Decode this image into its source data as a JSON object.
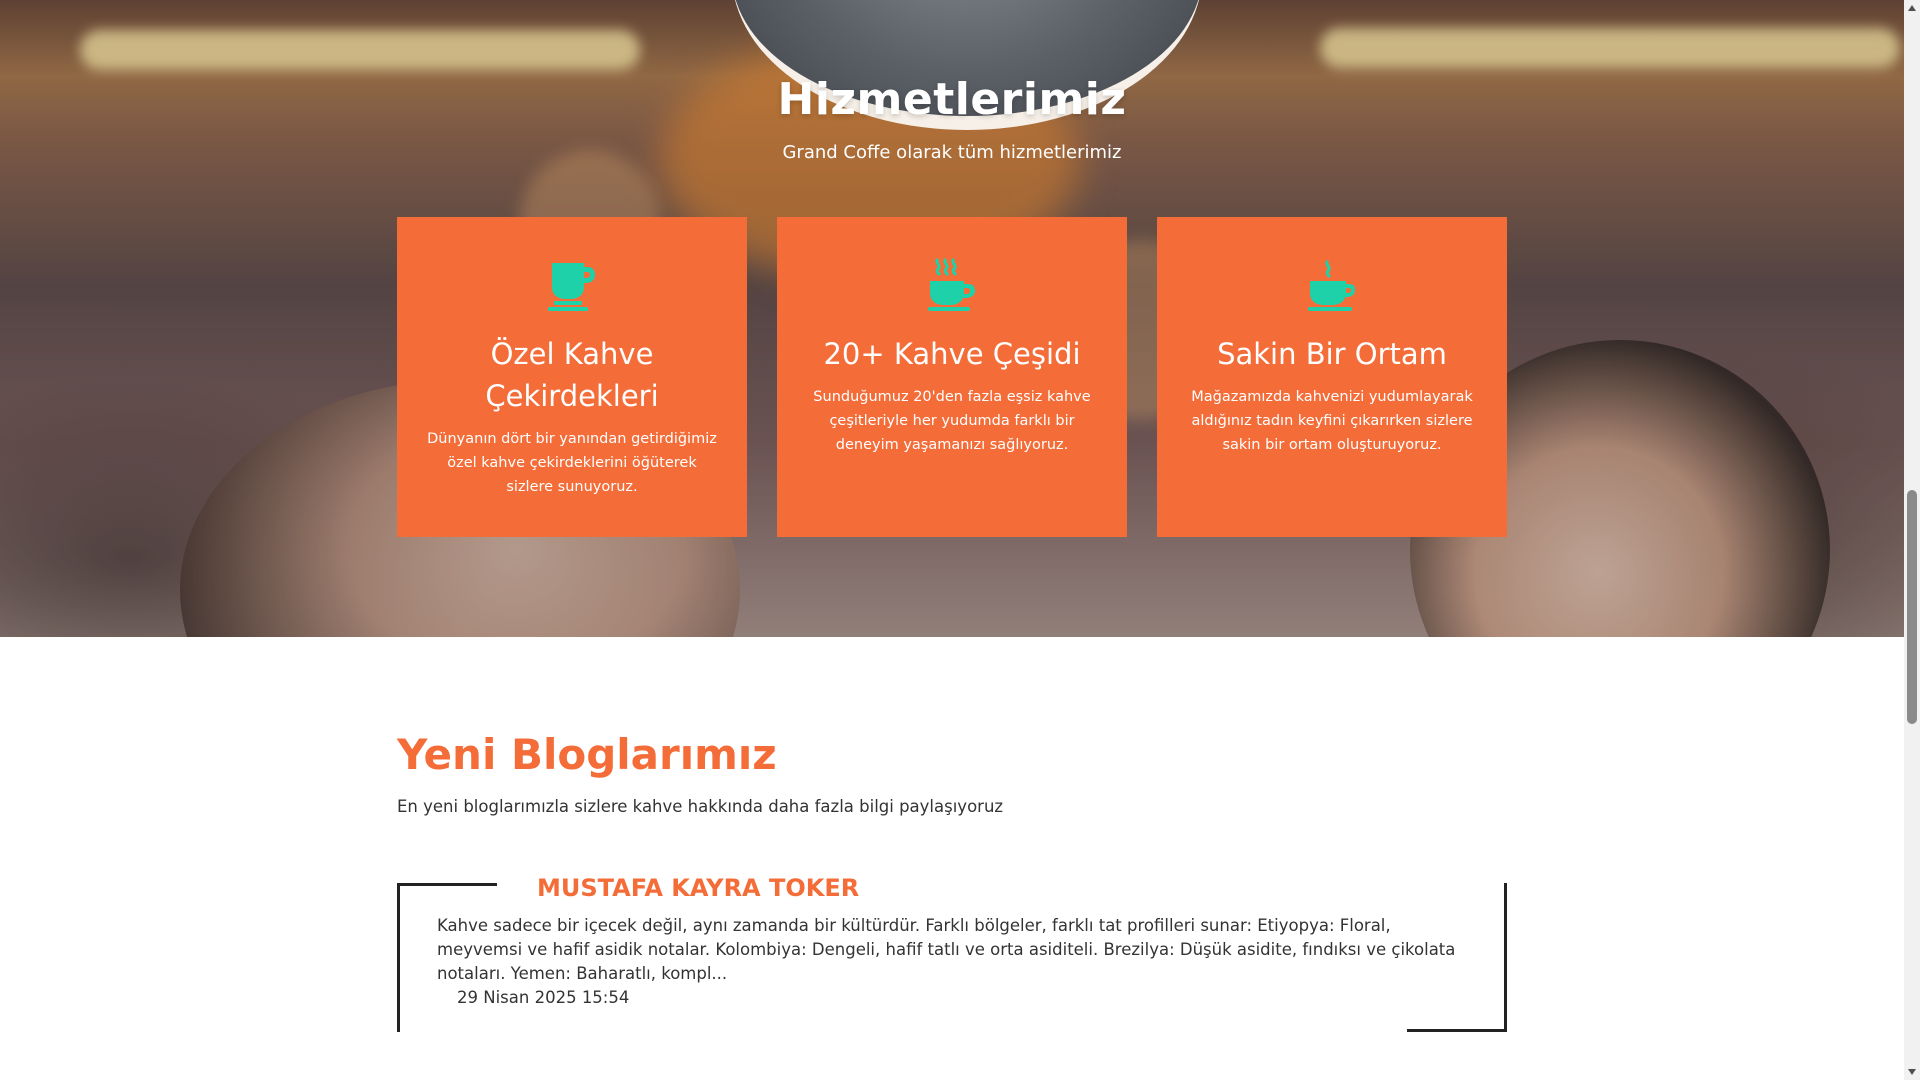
{
  "hero": {
    "title": "Hizmetlerimiz",
    "subtitle": "Grand Coffe olarak tüm hizmetlerimiz"
  },
  "services": [
    {
      "icon": "coffee-mug-icon",
      "title": "Özel Kahve Çekirdekleri",
      "text": "Dünyanın dört bir yanından getirdiğimiz özel kahve çekirdeklerini öğüterek sizlere sunuyoruz."
    },
    {
      "icon": "hot-coffee-cup-icon",
      "title": "20+ Kahve Çeşidi",
      "text": "Sunduğumuz 20'den fazla eşsiz kahve çeşitleriyle her yudumda farklı bir deneyim yaşamanızı sağlıyoruz."
    },
    {
      "icon": "steaming-cup-icon",
      "title": "Sakin Bir Ortam",
      "text": "Mağazamızda kahvenizi yudumlayarak aldığınız tadın keyfini çıkarırken sizlere sakin bir ortam oluşturuyoruz."
    }
  ],
  "blog": {
    "title": "Yeni Bloglarımız",
    "subtitle": "En yeni bloglarımızla sizlere kahve hakkında daha fazla bilgi paylaşıyoruz",
    "posts": [
      {
        "author": "MUSTAFA KAYRA TOKER",
        "excerpt": "Kahve sadece bir içecek değil, aynı zamanda bir kültürdür. Farklı bölgeler, farklı tat profilleri sunar: Etiyopya: Floral, meyvemsi ve hafif asidik notalar. Kolombiya: Dengeli, hafif tatlı ve orta asiditeli. Brezilya: Düşük asidite, fındıksı ve çikolata notaları. Yemen: Baharatlı, kompl...",
        "date": "29 Nisan 2025 15:54"
      }
    ]
  },
  "colors": {
    "accent": "#f46c38",
    "icon": "#1fd1a8",
    "text": "#333333"
  }
}
